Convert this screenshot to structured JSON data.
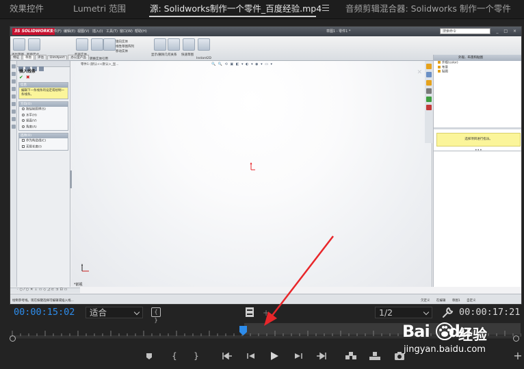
{
  "tabs": [
    {
      "label": "效果控件",
      "active": false
    },
    {
      "label": "Lumetri 范围",
      "active": false
    },
    {
      "label": "源: Solidworks制作一个零件_百度经验.mp4",
      "active": true
    },
    {
      "label": "音频剪辑混合器: Solidworks 制作一个零件",
      "active": false
    }
  ],
  "video_frame": {
    "sw_logo": "3S SOLIDWORKS",
    "menus": [
      "文件(F)",
      "编辑(E)",
      "视图(V)",
      "插入(I)",
      "工具(T)",
      "窗口(W)",
      "帮助(H)"
    ],
    "document": "草图1 - 零件1 *",
    "search_placeholder": "搜索命令",
    "window_buttons": "_ □ ×",
    "ribbon": [
      {
        "label": "退出草图"
      },
      {
        "label": "智能尺寸"
      },
      {
        "label": "剪裁实体"
      },
      {
        "label": "转换实体引用"
      },
      {
        "label": "等距实体"
      },
      {
        "label": "镜向实体"
      },
      {
        "label": "线性草图阵列"
      },
      {
        "label": "移动实体"
      },
      {
        "label": "显示/删除几何关系"
      },
      {
        "label": "修复草图"
      },
      {
        "label": "快速草图"
      },
      {
        "label": "Instant2D"
      }
    ],
    "command_tabs": [
      "特征",
      "草图",
      "评估",
      "DimXpert",
      "办公室产品"
    ],
    "property_manager": {
      "title": "插入线条",
      "message_header": "信息",
      "message": "编辑下一条线条的设定或绘制一条线条。",
      "orientation_header": "方向(O)",
      "orientation_options": [
        "按绘制原样(S)",
        "水平(H)",
        "竖直(V)",
        "角度(A)"
      ],
      "options_header": "选项(O)",
      "options": [
        "作为构造线(C)",
        "无限长度(I)"
      ]
    },
    "tree_breadcrumb": "零件1 (默认<<默认>_显...",
    "view_toolbar": "🔍 🔍 ⟲ ▣ ◧ ▾ ◐ ▾ ◉ ▾ ▭ ▾",
    "plane_label": "*前视",
    "task_pane": {
      "header": "外观、布景和贴图",
      "items": [
        "外观(color)",
        "布景",
        "贴图"
      ],
      "note": "选择项目进行指派。"
    },
    "status_left": "绘制参考线。现在按键选择可编辑或插入线...",
    "status_right": "欠定义  在编辑 草图1  自定义"
  },
  "controls": {
    "current_timecode": "00:00:15:02",
    "fit_select": "适合",
    "resolution_select": "1/2",
    "duration_timecode": "00:00:17:21",
    "playhead_percent": 45.6
  },
  "transport": [
    "marker",
    "mark-in",
    "mark-out",
    "go-to-in",
    "step-back",
    "play",
    "step-forward",
    "go-to-out",
    "insert",
    "overwrite",
    "export-frame",
    "add-button"
  ],
  "watermark": {
    "brand": "Bai",
    "brand_tail": "du",
    "cn": "经验",
    "url": "jingyan.baidu.com"
  },
  "colors": {
    "timecode_blue": "#2d8ceb",
    "annotation_red": "#e8262a",
    "yellow_note": "#fbf59a"
  }
}
